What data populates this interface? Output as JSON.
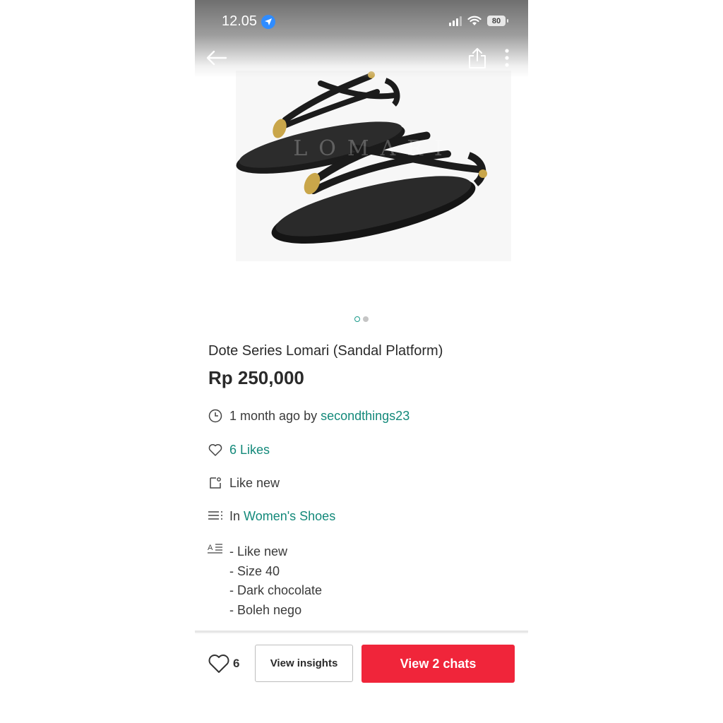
{
  "status_bar": {
    "time": "12.05",
    "battery": "80",
    "icons": [
      "location-arrow-icon",
      "signal-icon",
      "wifi-icon",
      "battery-icon"
    ]
  },
  "nav": {
    "icons": [
      "back-arrow-icon",
      "share-icon",
      "more-vertical-icon"
    ]
  },
  "gallery": {
    "watermark": "LOMARI",
    "current_index": 1,
    "total": 2
  },
  "listing": {
    "title": "Dote Series Lomari (Sandal Platform)",
    "price": "Rp 250,000",
    "posted_prefix": "1 month ago by",
    "seller": "secondthings23",
    "likes": "6 Likes",
    "condition": "Like new",
    "category_prefix": "In",
    "category": "Women's Shoes",
    "description": [
      "- Like new",
      "- Size 40",
      "- Dark chocolate",
      "- Boleh nego"
    ]
  },
  "bottom_bar": {
    "like_count": "6",
    "insights_label": "View insights",
    "chats_label": "View 2 chats"
  },
  "colors": {
    "accent": "#13897a",
    "primary_button": "#f0253a"
  }
}
